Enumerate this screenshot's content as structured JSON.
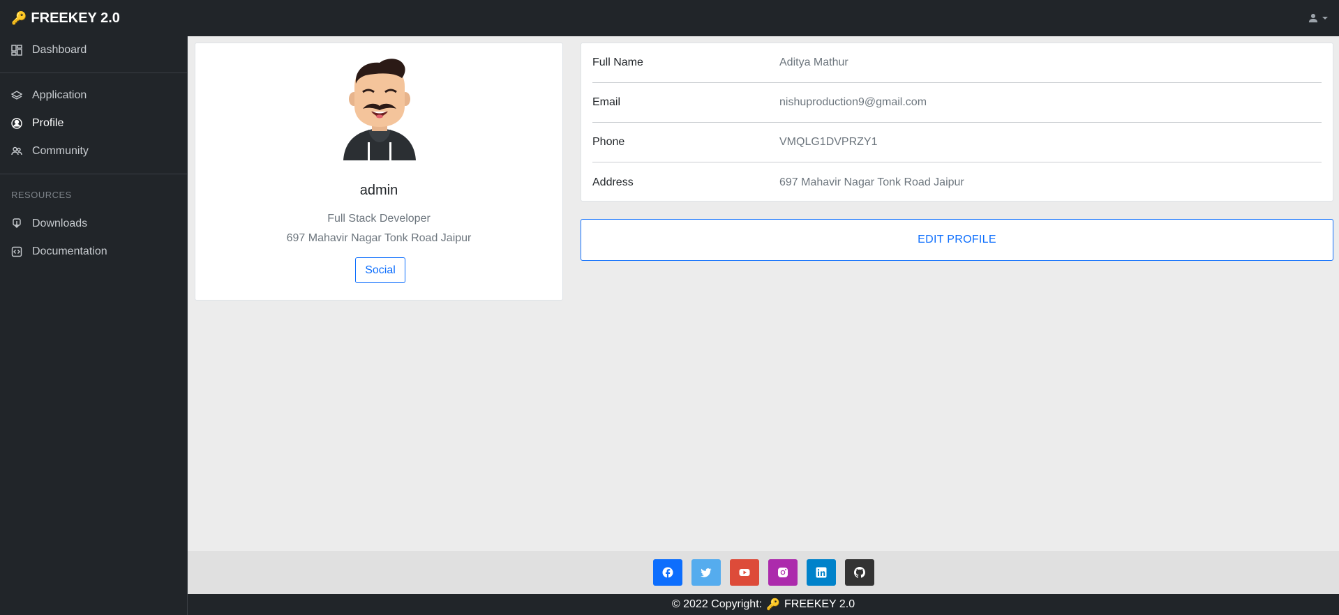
{
  "brand": {
    "icon": "key-icon",
    "name": "FREEKEY 2.0"
  },
  "user_menu": {
    "icon": "user-icon"
  },
  "sidebar": {
    "items": [
      {
        "label": "Dashboard",
        "icon": "dashboard-icon"
      },
      {
        "label": "Application",
        "icon": "layers-icon"
      },
      {
        "label": "Profile",
        "icon": "user-circle-icon",
        "active": true
      },
      {
        "label": "Community",
        "icon": "people-icon"
      }
    ],
    "section_label": "RESOURCES",
    "resources": [
      {
        "label": "Downloads",
        "icon": "download-icon"
      },
      {
        "label": "Documentation",
        "icon": "code-file-icon"
      }
    ]
  },
  "profile_card": {
    "name": "admin",
    "role": "Full Stack Developer",
    "address": "697 Mahavir Nagar Tonk Road Jaipur",
    "social_button": "Social"
  },
  "details": {
    "rows": [
      {
        "label": "Full Name",
        "value": "Aditya Mathur"
      },
      {
        "label": "Email",
        "value": "nishuproduction9@gmail.com"
      },
      {
        "label": "Phone",
        "value": "VMQLG1DVPRZY1"
      },
      {
        "label": "Address",
        "value": "697 Mahavir Nagar Tonk Road Jaipur"
      }
    ]
  },
  "edit_button": "EDIT PROFILE",
  "footer": {
    "social": [
      {
        "name": "facebook-icon",
        "color": "#0d6efd"
      },
      {
        "name": "twitter-icon",
        "color": "#55acee"
      },
      {
        "name": "youtube-icon",
        "color": "#dd4b39"
      },
      {
        "name": "instagram-icon",
        "color": "#ac2bac"
      },
      {
        "name": "linkedin-icon",
        "color": "#0082ca"
      },
      {
        "name": "github-icon",
        "color": "#333333"
      }
    ],
    "copyright_prefix": "© 2022 Copyright:",
    "copyright_brand": "FREEKEY 2.0"
  },
  "colors": {
    "primary": "#0d6efd",
    "dark": "#212529",
    "muted": "#6c757d",
    "page_bg": "#ececec"
  }
}
